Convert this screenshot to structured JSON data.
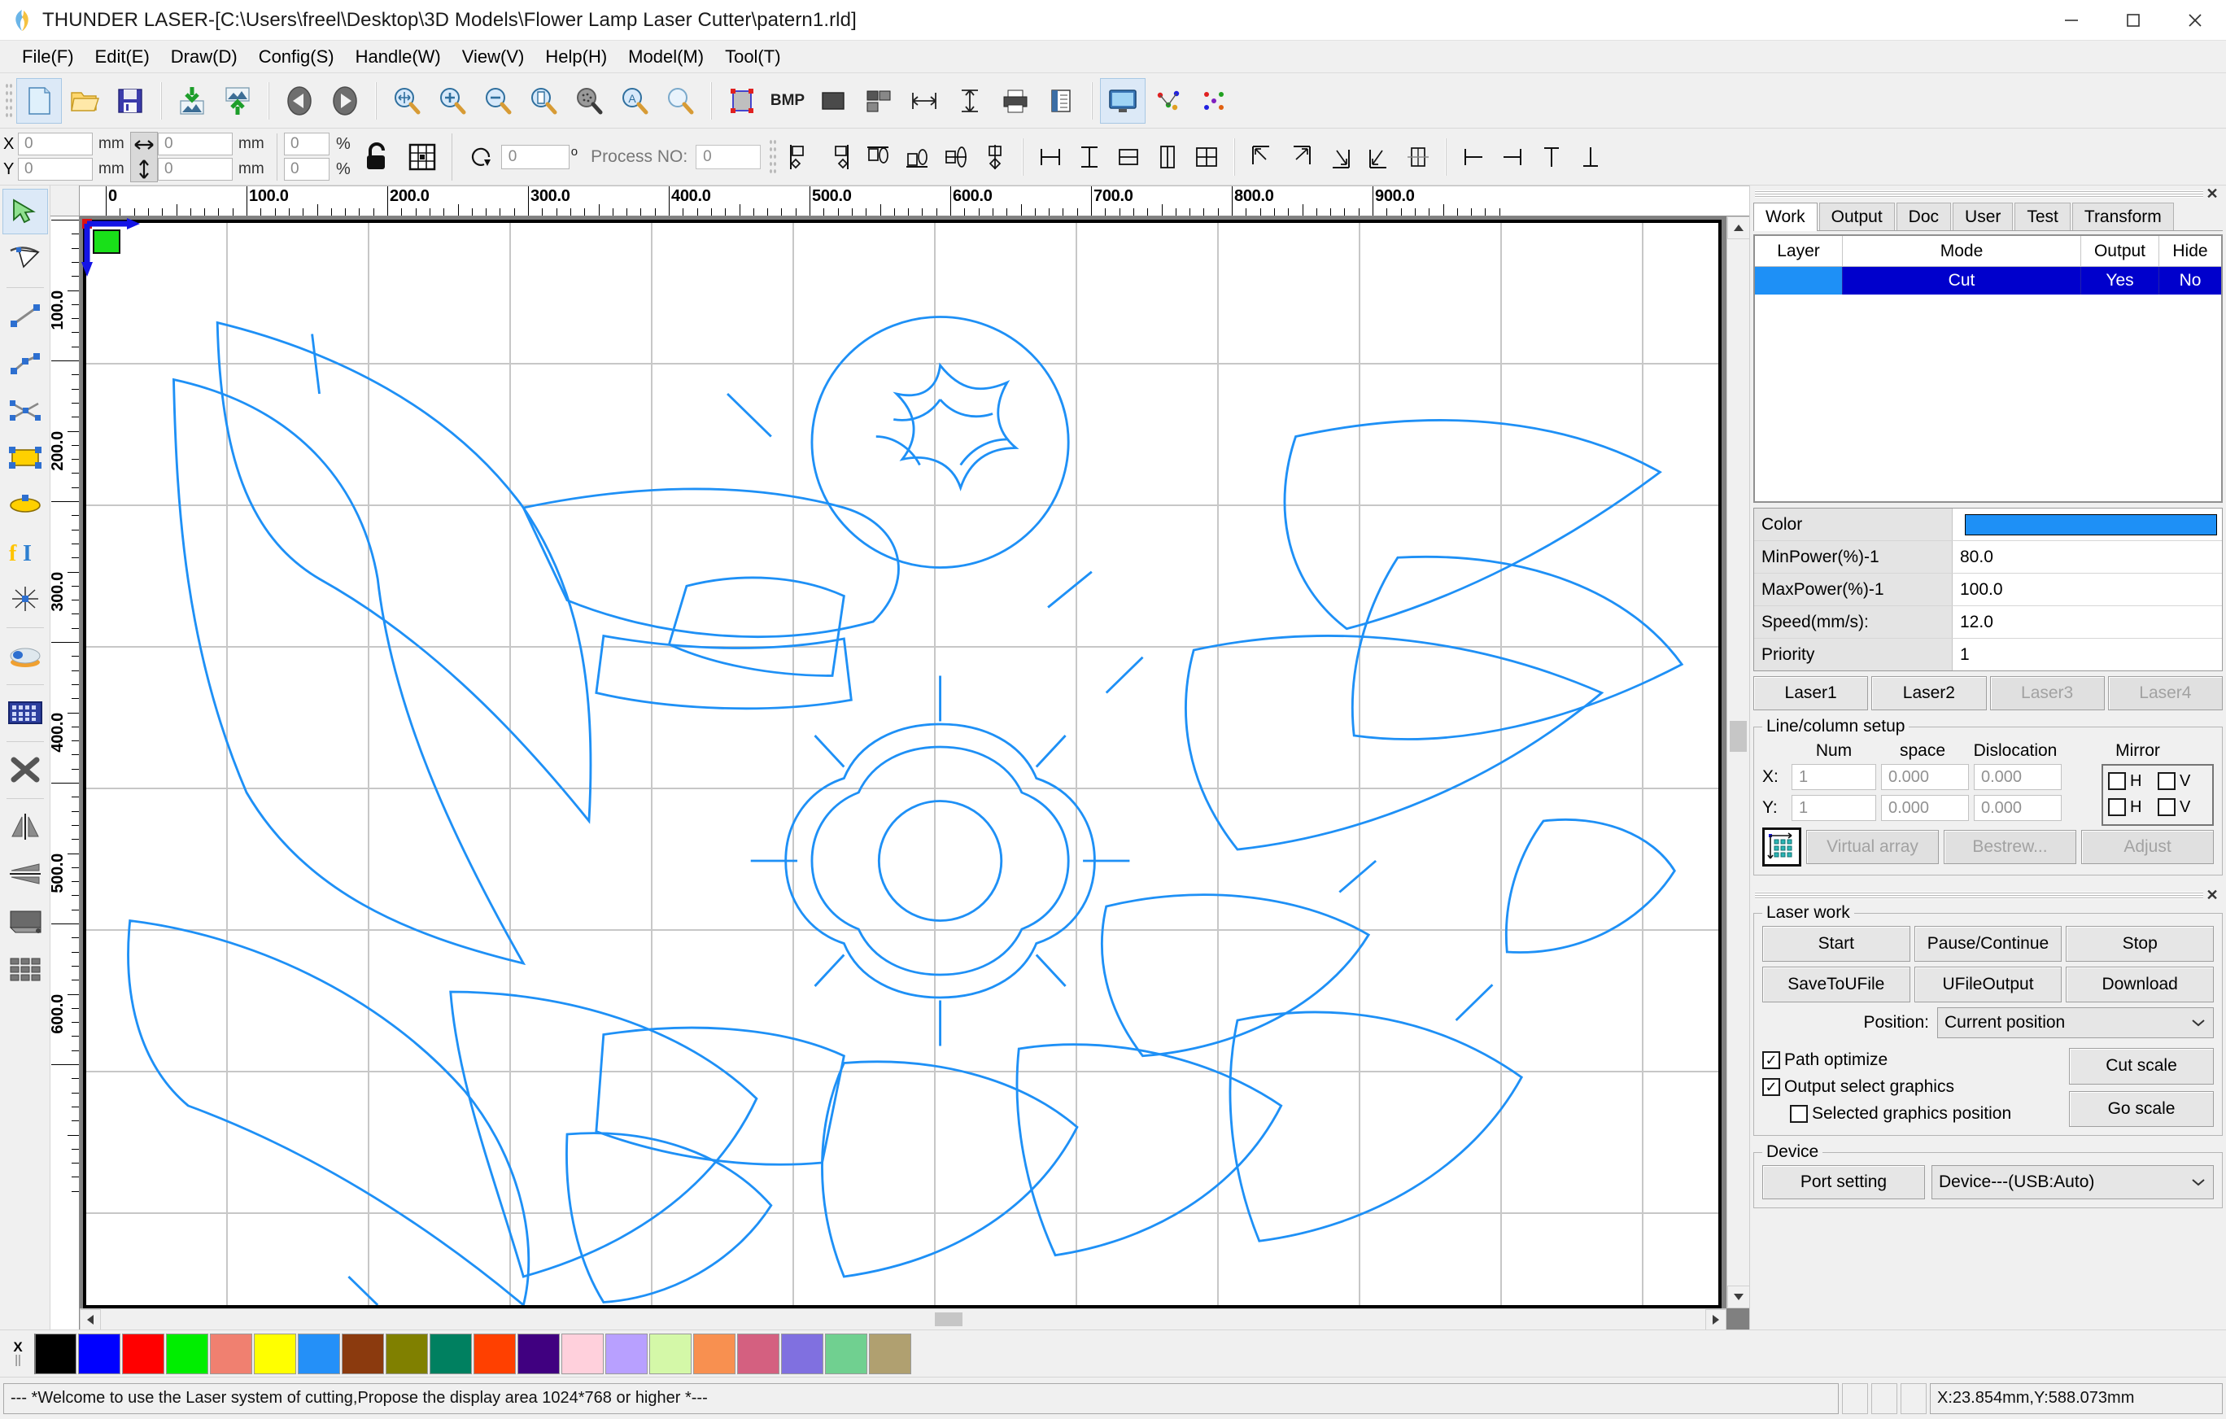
{
  "window": {
    "title": "THUNDER LASER-[C:\\Users\\freel\\Desktop\\3D Models\\Flower Lamp Laser Cutter\\patern1.rld]",
    "app_icon": "thunder-laser-icon",
    "minimize": "minimize-icon",
    "maximize": "maximize-icon",
    "close": "close-icon"
  },
  "menubar": {
    "items": [
      {
        "label": "File(F)"
      },
      {
        "label": "Edit(E)"
      },
      {
        "label": "Draw(D)"
      },
      {
        "label": "Config(S)"
      },
      {
        "label": "Handle(W)"
      },
      {
        "label": "View(V)"
      },
      {
        "label": "Help(H)"
      },
      {
        "label": "Model(M)"
      },
      {
        "label": "Tool(T)"
      }
    ]
  },
  "toolbar_main": {
    "groups": [
      {
        "buttons": [
          {
            "name": "new-file-icon",
            "title": "New"
          },
          {
            "name": "open-file-icon",
            "title": "Open"
          },
          {
            "name": "save-file-icon",
            "title": "Save"
          }
        ]
      },
      {
        "buttons": [
          {
            "name": "import-image-icon",
            "title": "Import"
          },
          {
            "name": "export-image-icon",
            "title": "Export"
          }
        ]
      },
      {
        "buttons": [
          {
            "name": "undo-arrow-icon",
            "title": "Undo"
          },
          {
            "name": "redo-arrow-icon",
            "title": "Redo"
          }
        ]
      },
      {
        "buttons": [
          {
            "name": "zoom-fit-icon",
            "title": "Zoom to fit"
          },
          {
            "name": "zoom-in-icon",
            "title": "Zoom in"
          },
          {
            "name": "zoom-out-icon",
            "title": "Zoom out"
          },
          {
            "name": "zoom-page-icon",
            "title": "Zoom page"
          },
          {
            "name": "zoom-selection-icon",
            "title": "Zoom selection"
          },
          {
            "name": "zoom-all-icon",
            "title": "Zoom all"
          },
          {
            "name": "zoom-region-icon",
            "title": "Zoom region"
          }
        ]
      },
      {
        "buttons": [
          {
            "name": "bounding-box-icon",
            "title": "Bounds"
          },
          {
            "name": "bitmap-icon",
            "title": "BMP",
            "text": "BMP"
          },
          {
            "name": "fill-shape-icon",
            "title": "Fill"
          },
          {
            "name": "group-icon",
            "title": "Group"
          },
          {
            "name": "measure-horizontal-icon",
            "title": "Measure H"
          },
          {
            "name": "measure-vertical-icon",
            "title": "Measure V"
          },
          {
            "name": "print-icon",
            "title": "Print"
          },
          {
            "name": "page-setup-icon",
            "title": "Page setup"
          }
        ]
      },
      {
        "buttons": [
          {
            "name": "monitor-preview-icon",
            "title": "Preview"
          },
          {
            "name": "node-edit-icon",
            "title": "Node edit"
          },
          {
            "name": "node-edit-alt-icon",
            "title": "Node edit 2"
          }
        ]
      }
    ]
  },
  "toolbar_transform": {
    "x_label": "X",
    "y_label": "Y",
    "x_value": "0",
    "y_value": "0",
    "width_value": "0",
    "height_value": "0",
    "scale_x_value": "0",
    "scale_y_value": "0",
    "unit": "mm",
    "percent": "%",
    "lock_icon": "padlock-icon",
    "anchor_icon": "anchor-grid-icon",
    "rotate_icon": "rotate-icon",
    "rotate_value": "0",
    "degree_symbol": "o",
    "process_label": "Process NO:",
    "process_value": "0",
    "align_buttons": [
      {
        "name": "align-left-icon"
      },
      {
        "name": "align-right-icon"
      },
      {
        "name": "align-top-icon"
      },
      {
        "name": "align-bottom-icon"
      },
      {
        "name": "align-center-vertical-icon"
      },
      {
        "name": "align-center-horizontal-icon"
      },
      {
        "name": "distribute-horizontal-icon"
      },
      {
        "name": "distribute-vertical-icon"
      },
      {
        "name": "same-height-icon"
      },
      {
        "name": "same-width-icon"
      },
      {
        "name": "same-size-icon"
      },
      {
        "name": "snap-top-left-icon"
      },
      {
        "name": "snap-top-right-icon"
      },
      {
        "name": "snap-bottom-right-icon"
      },
      {
        "name": "snap-bottom-left-icon"
      },
      {
        "name": "snap-center-icon"
      },
      {
        "name": "origin-left-icon"
      },
      {
        "name": "origin-right-icon"
      },
      {
        "name": "origin-top-icon"
      },
      {
        "name": "origin-bottom-icon"
      }
    ]
  },
  "left_toolbar": {
    "tools": [
      {
        "name": "select-arrow-tool",
        "active": true
      },
      {
        "name": "node-edit-tool",
        "active": false
      },
      {
        "name": "line-tool",
        "active": false
      },
      {
        "name": "polyline-tool",
        "active": false
      },
      {
        "name": "bezier-tool",
        "active": false
      },
      {
        "name": "rectangle-tool",
        "active": false
      },
      {
        "name": "ellipse-tool",
        "active": false
      },
      {
        "name": "text-tool",
        "active": false
      },
      {
        "name": "dot-burst-tool",
        "active": false
      },
      {
        "name": "capture-camera-tool",
        "active": false
      },
      {
        "name": "array-grid-tool",
        "active": false
      },
      {
        "name": "delete-x-tool",
        "active": false
      },
      {
        "name": "mirror-horizontal-tool",
        "active": false
      },
      {
        "name": "mirror-vertical-tool",
        "active": false
      },
      {
        "name": "platform-tool",
        "active": false
      },
      {
        "name": "grid-cells-tool",
        "active": false
      }
    ]
  },
  "canvas": {
    "h_ruler_labels": [
      "0",
      "100.0",
      "200.0",
      "300.0",
      "400.0",
      "500.0",
      "600.0",
      "700.0",
      "800.0",
      "900.0"
    ],
    "v_ruler_labels": [
      "100.0",
      "200.0",
      "300.0",
      "400.0",
      "500.0",
      "600.0"
    ],
    "origin_marker": "origin-axis-marker",
    "drawing_color": "#1e90f6",
    "grid_color": "#9a9a9a",
    "scroll_left_icon": "scroll-left-icon",
    "scroll_right_icon": "scroll-right-icon",
    "scroll_up_icon": "scroll-up-icon",
    "scroll_down_icon": "scroll-down-icon"
  },
  "right_panel": {
    "close_icon": "close-panel-icon",
    "tabs": [
      {
        "label": "Work",
        "active": true
      },
      {
        "label": "Output",
        "active": false
      },
      {
        "label": "Doc",
        "active": false
      },
      {
        "label": "User",
        "active": false
      },
      {
        "label": "Test",
        "active": false
      },
      {
        "label": "Transform",
        "active": false
      }
    ],
    "layer_table": {
      "headers": [
        "Layer",
        "Mode",
        "Output",
        "Hide"
      ],
      "rows": [
        {
          "layer_color": "#1e90f6",
          "mode": "Cut",
          "output": "Yes",
          "hide": "No",
          "selected": true
        }
      ]
    },
    "properties": [
      {
        "key": "Color",
        "value": "",
        "is_color": true,
        "color": "#1e90f6"
      },
      {
        "key": "MinPower(%)-1",
        "value": "80.0",
        "is_color": false
      },
      {
        "key": "MaxPower(%)-1",
        "value": "100.0",
        "is_color": false
      },
      {
        "key": "Speed(mm/s):",
        "value": "12.0",
        "is_color": false
      },
      {
        "key": "Priority",
        "value": "1",
        "is_color": false
      }
    ],
    "laser_tabs": [
      {
        "label": "Laser1",
        "disabled": false
      },
      {
        "label": "Laser2",
        "disabled": false
      },
      {
        "label": "Laser3",
        "disabled": true
      },
      {
        "label": "Laser4",
        "disabled": true
      }
    ],
    "line_column_setup": {
      "legend": "Line/column setup",
      "headers": [
        "Num",
        "space",
        "Dislocation",
        "Mirror"
      ],
      "rows": [
        {
          "axis": "X:",
          "num": "1",
          "space": "0.000",
          "dislocation": "0.000",
          "mirror_h_label": "H",
          "mirror_v_label": "V",
          "mirror_h": false,
          "mirror_v": false
        },
        {
          "axis": "Y:",
          "num": "1",
          "space": "0.000",
          "dislocation": "0.000",
          "mirror_h_label": "H",
          "mirror_v_label": "V",
          "mirror_h": false,
          "mirror_v": false
        }
      ],
      "array_icon": "array-grid-icon",
      "buttons": [
        {
          "label": "Virtual array",
          "disabled": true
        },
        {
          "label": "Bestrew...",
          "disabled": true
        },
        {
          "label": "Adjust",
          "disabled": true
        }
      ]
    },
    "laser_work": {
      "legend": "Laser work",
      "row1": [
        "Start",
        "Pause/Continue",
        "Stop"
      ],
      "row2": [
        "SaveToUFile",
        "UFileOutput",
        "Download"
      ],
      "position_label": "Position:",
      "position_value": "Current position",
      "options": [
        {
          "label": "Path optimize",
          "checked": true,
          "indent": false
        },
        {
          "label": "Output select graphics",
          "checked": true,
          "indent": false
        },
        {
          "label": "Selected graphics position",
          "checked": false,
          "indent": true
        }
      ],
      "side_buttons": [
        "Cut scale",
        "Go scale"
      ]
    },
    "device": {
      "legend": "Device",
      "port_setting": "Port setting",
      "device_value": "Device---(USB:Auto)"
    }
  },
  "palette": {
    "x_label": "X",
    "bar_label": "||",
    "colors": [
      "#000000",
      "#0000ff",
      "#ff0000",
      "#00ee00",
      "#f08070",
      "#ffff00",
      "#2490f8",
      "#8b3a0e",
      "#808000",
      "#008060",
      "#ff4000",
      "#400080",
      "#ffd0dc",
      "#b8a0ff",
      "#d4f8a8",
      "#f89050",
      "#d46080",
      "#8070e0",
      "#70d090",
      "#b0a070"
    ]
  },
  "statusbar": {
    "message": "--- *Welcome to use the Laser system of cutting,Propose the display area 1024*768 or higher *---",
    "coordinates": "X:23.854mm,Y:588.073mm"
  }
}
